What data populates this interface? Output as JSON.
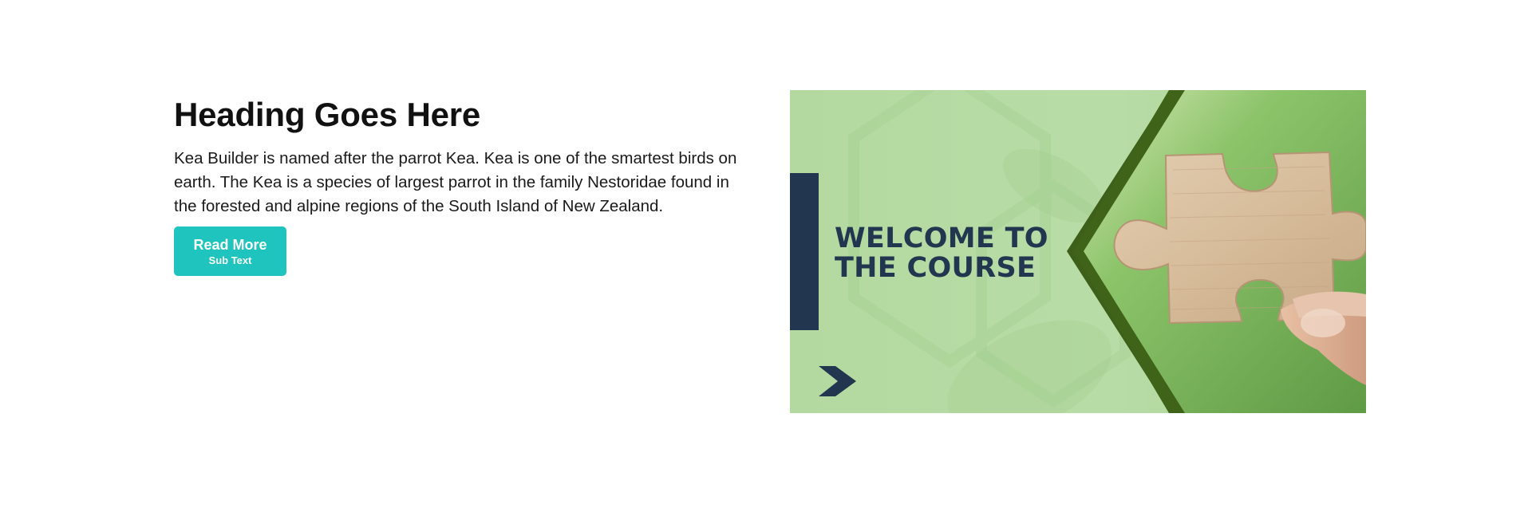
{
  "content": {
    "heading": "Heading Goes Here",
    "paragraph": "Kea Builder is named after the parrot Kea. Kea is one of the smartest birds on earth. The Kea is a species of largest parrot in the family Nestoridae found in the forested and alpine regions of the South Island of New Zealand.",
    "button": {
      "label": "Read More",
      "sublabel": "Sub Text"
    }
  },
  "banner": {
    "title_line1": "WELCOME TO",
    "title_line2": "THE COURSE",
    "icons": [
      "chevron-right-icon",
      "puzzle-piece-icon"
    ]
  },
  "colors": {
    "button": "#1ec4bd",
    "heading": "#111111",
    "banner_navy": "#22374f",
    "banner_green": "#b5da a3",
    "banner_dark_green": "#3e5f1a"
  }
}
